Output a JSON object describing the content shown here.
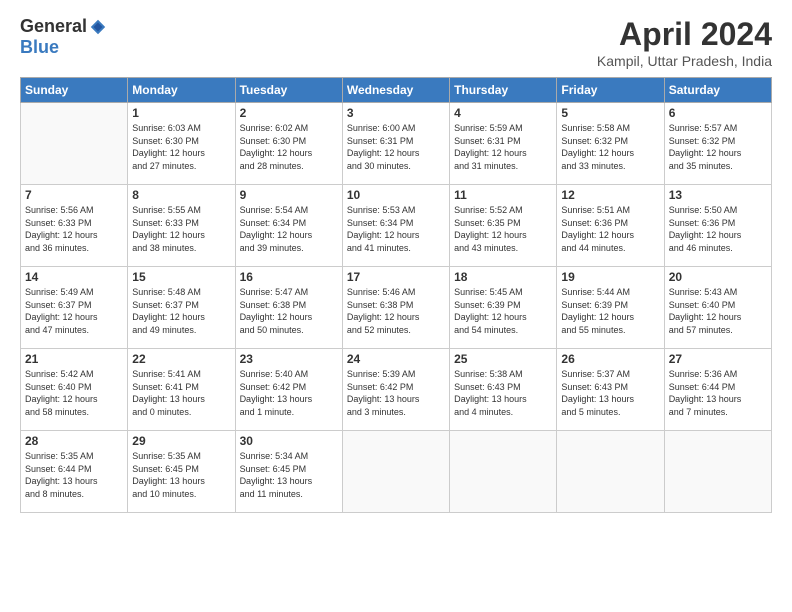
{
  "header": {
    "logo_general": "General",
    "logo_blue": "Blue",
    "month_year": "April 2024",
    "location": "Kampil, Uttar Pradesh, India"
  },
  "weekdays": [
    "Sunday",
    "Monday",
    "Tuesday",
    "Wednesday",
    "Thursday",
    "Friday",
    "Saturday"
  ],
  "weeks": [
    [
      {
        "day": "",
        "info": ""
      },
      {
        "day": "1",
        "info": "Sunrise: 6:03 AM\nSunset: 6:30 PM\nDaylight: 12 hours\nand 27 minutes."
      },
      {
        "day": "2",
        "info": "Sunrise: 6:02 AM\nSunset: 6:30 PM\nDaylight: 12 hours\nand 28 minutes."
      },
      {
        "day": "3",
        "info": "Sunrise: 6:00 AM\nSunset: 6:31 PM\nDaylight: 12 hours\nand 30 minutes."
      },
      {
        "day": "4",
        "info": "Sunrise: 5:59 AM\nSunset: 6:31 PM\nDaylight: 12 hours\nand 31 minutes."
      },
      {
        "day": "5",
        "info": "Sunrise: 5:58 AM\nSunset: 6:32 PM\nDaylight: 12 hours\nand 33 minutes."
      },
      {
        "day": "6",
        "info": "Sunrise: 5:57 AM\nSunset: 6:32 PM\nDaylight: 12 hours\nand 35 minutes."
      }
    ],
    [
      {
        "day": "7",
        "info": "Sunrise: 5:56 AM\nSunset: 6:33 PM\nDaylight: 12 hours\nand 36 minutes."
      },
      {
        "day": "8",
        "info": "Sunrise: 5:55 AM\nSunset: 6:33 PM\nDaylight: 12 hours\nand 38 minutes."
      },
      {
        "day": "9",
        "info": "Sunrise: 5:54 AM\nSunset: 6:34 PM\nDaylight: 12 hours\nand 39 minutes."
      },
      {
        "day": "10",
        "info": "Sunrise: 5:53 AM\nSunset: 6:34 PM\nDaylight: 12 hours\nand 41 minutes."
      },
      {
        "day": "11",
        "info": "Sunrise: 5:52 AM\nSunset: 6:35 PM\nDaylight: 12 hours\nand 43 minutes."
      },
      {
        "day": "12",
        "info": "Sunrise: 5:51 AM\nSunset: 6:36 PM\nDaylight: 12 hours\nand 44 minutes."
      },
      {
        "day": "13",
        "info": "Sunrise: 5:50 AM\nSunset: 6:36 PM\nDaylight: 12 hours\nand 46 minutes."
      }
    ],
    [
      {
        "day": "14",
        "info": "Sunrise: 5:49 AM\nSunset: 6:37 PM\nDaylight: 12 hours\nand 47 minutes."
      },
      {
        "day": "15",
        "info": "Sunrise: 5:48 AM\nSunset: 6:37 PM\nDaylight: 12 hours\nand 49 minutes."
      },
      {
        "day": "16",
        "info": "Sunrise: 5:47 AM\nSunset: 6:38 PM\nDaylight: 12 hours\nand 50 minutes."
      },
      {
        "day": "17",
        "info": "Sunrise: 5:46 AM\nSunset: 6:38 PM\nDaylight: 12 hours\nand 52 minutes."
      },
      {
        "day": "18",
        "info": "Sunrise: 5:45 AM\nSunset: 6:39 PM\nDaylight: 12 hours\nand 54 minutes."
      },
      {
        "day": "19",
        "info": "Sunrise: 5:44 AM\nSunset: 6:39 PM\nDaylight: 12 hours\nand 55 minutes."
      },
      {
        "day": "20",
        "info": "Sunrise: 5:43 AM\nSunset: 6:40 PM\nDaylight: 12 hours\nand 57 minutes."
      }
    ],
    [
      {
        "day": "21",
        "info": "Sunrise: 5:42 AM\nSunset: 6:40 PM\nDaylight: 12 hours\nand 58 minutes."
      },
      {
        "day": "22",
        "info": "Sunrise: 5:41 AM\nSunset: 6:41 PM\nDaylight: 13 hours\nand 0 minutes."
      },
      {
        "day": "23",
        "info": "Sunrise: 5:40 AM\nSunset: 6:42 PM\nDaylight: 13 hours\nand 1 minute."
      },
      {
        "day": "24",
        "info": "Sunrise: 5:39 AM\nSunset: 6:42 PM\nDaylight: 13 hours\nand 3 minutes."
      },
      {
        "day": "25",
        "info": "Sunrise: 5:38 AM\nSunset: 6:43 PM\nDaylight: 13 hours\nand 4 minutes."
      },
      {
        "day": "26",
        "info": "Sunrise: 5:37 AM\nSunset: 6:43 PM\nDaylight: 13 hours\nand 5 minutes."
      },
      {
        "day": "27",
        "info": "Sunrise: 5:36 AM\nSunset: 6:44 PM\nDaylight: 13 hours\nand 7 minutes."
      }
    ],
    [
      {
        "day": "28",
        "info": "Sunrise: 5:35 AM\nSunset: 6:44 PM\nDaylight: 13 hours\nand 8 minutes."
      },
      {
        "day": "29",
        "info": "Sunrise: 5:35 AM\nSunset: 6:45 PM\nDaylight: 13 hours\nand 10 minutes."
      },
      {
        "day": "30",
        "info": "Sunrise: 5:34 AM\nSunset: 6:45 PM\nDaylight: 13 hours\nand 11 minutes."
      },
      {
        "day": "",
        "info": ""
      },
      {
        "day": "",
        "info": ""
      },
      {
        "day": "",
        "info": ""
      },
      {
        "day": "",
        "info": ""
      }
    ]
  ]
}
